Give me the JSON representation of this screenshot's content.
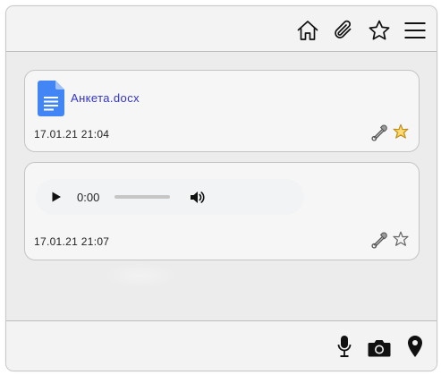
{
  "header": {
    "icons": [
      "home-icon",
      "paperclip-icon",
      "star-icon",
      "menu-icon"
    ]
  },
  "messages": [
    {
      "type": "file",
      "file_icon": "google-doc-icon",
      "filename": "Анкета.docx",
      "timestamp": "17.01.21 21:04",
      "pin_icon": "safety-pin-icon",
      "starred": true
    },
    {
      "type": "audio",
      "current_time": "0:00",
      "progress": 0,
      "timestamp": "17.01.21 21:07",
      "pin_icon": "safety-pin-icon",
      "starred": false
    }
  ],
  "footer": {
    "icons": [
      "microphone-icon",
      "camera-icon",
      "location-pin-icon"
    ]
  },
  "colors": {
    "link": "#3333cc",
    "doc_blue": "#4285f4",
    "star_filled": "#f5c242"
  }
}
